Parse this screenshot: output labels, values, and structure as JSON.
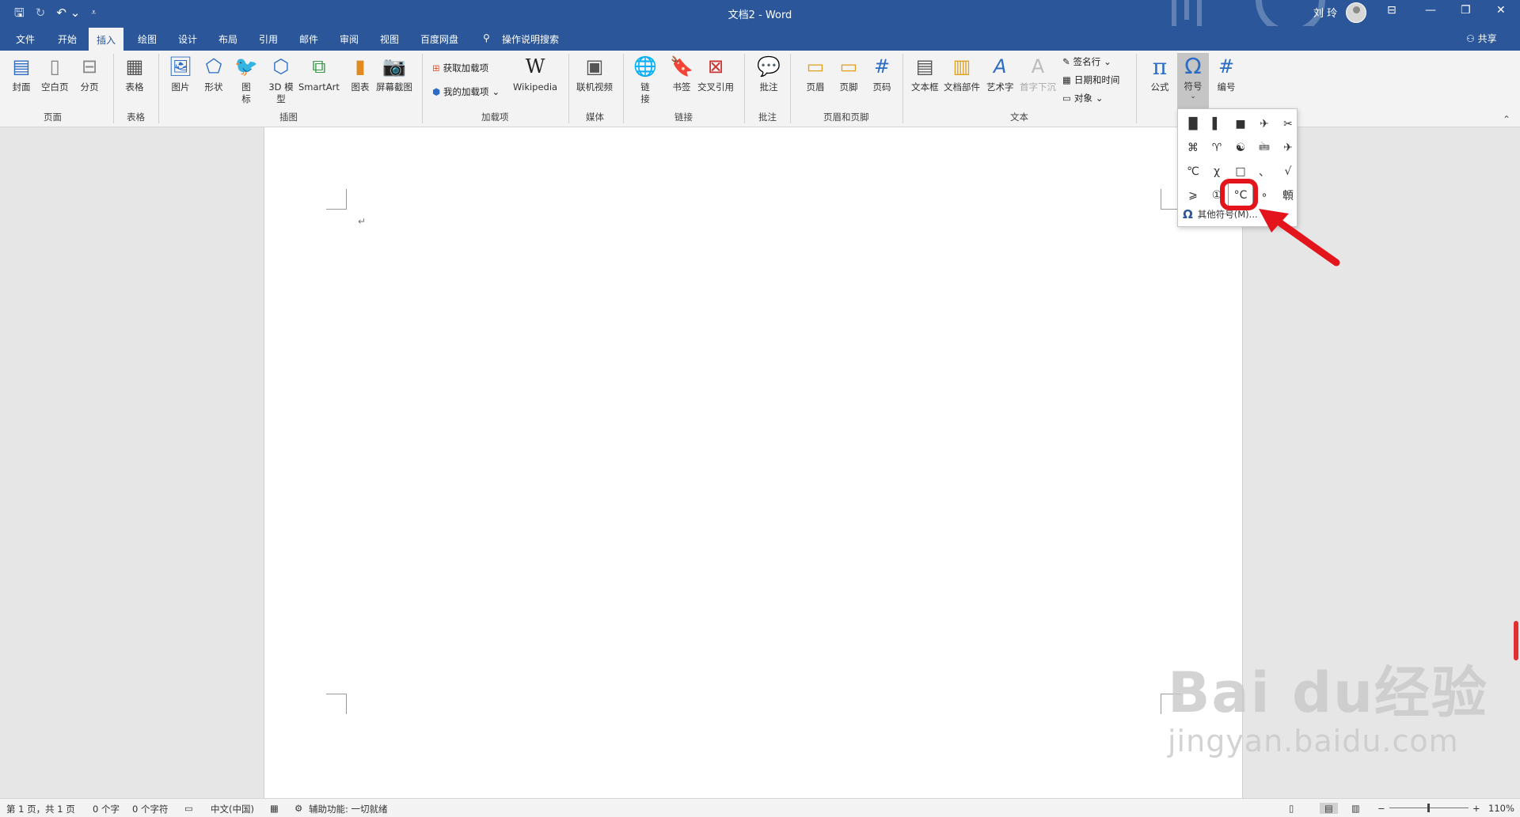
{
  "titlebar": {
    "title": "文档2 - Word",
    "user": "刘 玲",
    "qat": {
      "save_icon": "save-icon",
      "redo_icon": "redo-icon",
      "undo_icon": "undo-icon",
      "customize_icon": "customize-icon"
    }
  },
  "tabs": [
    "文件",
    "开始",
    "插入",
    "绘图",
    "设计",
    "布局",
    "引用",
    "邮件",
    "审阅",
    "视图",
    "百度网盘"
  ],
  "active_tab": "插入",
  "tell_me": "操作说明搜索",
  "share": "共享",
  "ribbon": {
    "pages": {
      "cover": "封面",
      "blank": "空白页",
      "break": "分页",
      "group": "页面"
    },
    "tables": {
      "table": "表格",
      "group": "表格"
    },
    "illustrations": {
      "picture": "图片",
      "shapes": "形状",
      "icons": "图标",
      "models": "3D 模型",
      "smartart": "SmartArt",
      "chart": "图表",
      "screenshot": "屏幕截图",
      "group": "插图"
    },
    "addins": {
      "get": "获取加载项",
      "my": "我的加载项",
      "wikipedia": "Wikipedia",
      "group": "加载项"
    },
    "media": {
      "video": "联机视频",
      "group": "媒体"
    },
    "links": {
      "link": "链接",
      "bookmark": "书签",
      "crossref": "交叉引用",
      "group": "链接"
    },
    "comments": {
      "comment": "批注",
      "group": "批注"
    },
    "headerfooter": {
      "header": "页眉",
      "footer": "页脚",
      "pagenum": "页码",
      "group": "页眉和页脚"
    },
    "text": {
      "textbox": "文本框",
      "quickparts": "文档部件",
      "wordart": "艺术字",
      "dropcap": "首字下沉",
      "signature": "签名行",
      "datetime": "日期和时间",
      "object": "对象",
      "group": "文本"
    },
    "symbols": {
      "equation": "公式",
      "symbol": "符号",
      "number": "编号"
    }
  },
  "symbol_dropdown": {
    "symbols": [
      "█",
      "▌",
      "■",
      "✈",
      "✂",
      "⌘",
      "♈",
      "☯",
      "🖮",
      "✈",
      "℃",
      "χ",
      "□",
      "、",
      "√",
      "⩾",
      "①",
      "°C",
      "∘",
      "䫌"
    ],
    "highlighted": "°C",
    "more_label": "其他符号(M)..."
  },
  "document": {
    "paragraph_mark": "↵"
  },
  "watermark": {
    "brand": "Bai du经验",
    "url": "jingyan.baidu.com"
  },
  "status": {
    "page": "第 1 页，共 1 页",
    "words": "0 个字",
    "chars": "0 个字符",
    "language": "中文(中国)",
    "accessibility": "辅助功能: 一切就绪",
    "zoom": "110%"
  },
  "colors": {
    "accent": "#2b579a",
    "highlight": "#e4141c"
  }
}
